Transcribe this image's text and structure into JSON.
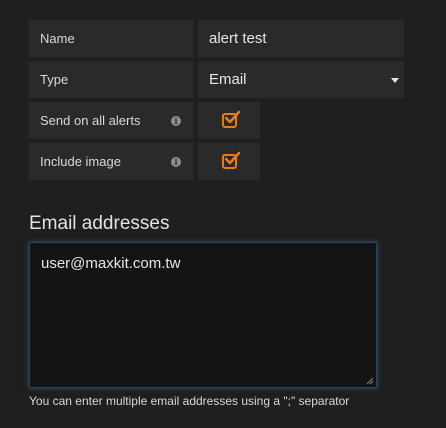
{
  "fields": {
    "name": {
      "label": "Name",
      "value": "alert test"
    },
    "type": {
      "label": "Type",
      "value": "Email"
    },
    "send_on_all_alerts": {
      "label": "Send on all alerts",
      "checked": true
    },
    "include_image": {
      "label": "Include image",
      "checked": true
    }
  },
  "email": {
    "section_title": "Email addresses",
    "value": "user@maxkit.com.tw",
    "help": "You can enter multiple email addresses using a \";\" separator"
  },
  "icons": {
    "info": "info-icon",
    "checkmark": "checkmark-icon",
    "dropdown": "chevron-down-icon"
  },
  "colors": {
    "accent": "#eb7b18",
    "panel": "#2a2a2b",
    "background": "#1f1f20",
    "focus_glow": "#4880ba"
  }
}
